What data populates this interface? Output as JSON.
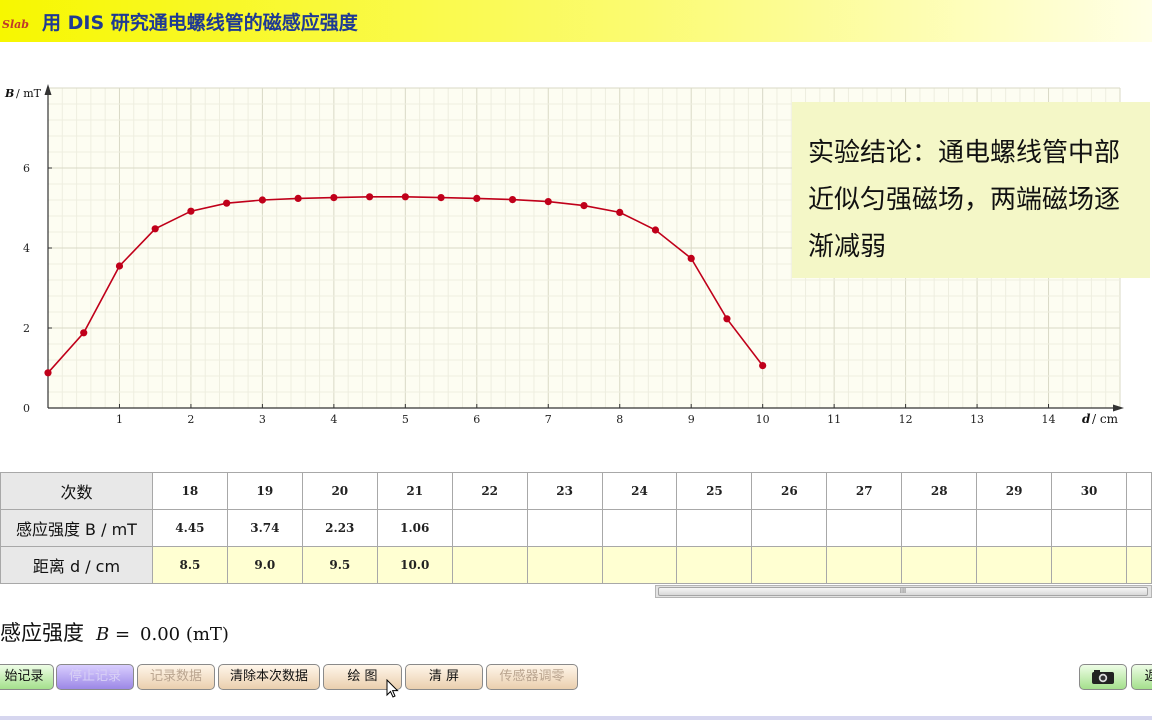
{
  "app": {
    "logo_text": "Slab",
    "title": "用 DIS 研究通电螺线管的磁感应强度"
  },
  "chart_data": {
    "type": "line",
    "xlabel_var": "d",
    "xlabel_unit": "/ cm",
    "ylabel_var": "B",
    "ylabel_unit": "/ mT",
    "xlim": [
      0,
      15
    ],
    "ylim": [
      0,
      8
    ],
    "xticks": [
      1,
      2,
      3,
      4,
      5,
      6,
      7,
      8,
      9,
      10,
      11,
      12,
      13,
      14
    ],
    "yticks": [
      0,
      2,
      4,
      6
    ],
    "grid": true,
    "series": [
      {
        "color": "#c0001a",
        "points": [
          [
            0,
            0.88
          ],
          [
            0.5,
            1.88
          ],
          [
            1,
            3.55
          ],
          [
            1.5,
            4.48
          ],
          [
            2,
            4.92
          ],
          [
            2.5,
            5.12
          ],
          [
            3,
            5.2
          ],
          [
            3.5,
            5.24
          ],
          [
            4,
            5.26
          ],
          [
            4.5,
            5.28
          ],
          [
            5,
            5.28
          ],
          [
            5.5,
            5.26
          ],
          [
            6,
            5.24
          ],
          [
            6.5,
            5.21
          ],
          [
            7,
            5.16
          ],
          [
            7.5,
            5.06
          ],
          [
            8,
            4.89
          ],
          [
            8.5,
            4.45
          ],
          [
            9,
            3.74
          ],
          [
            9.5,
            2.23
          ],
          [
            10,
            1.06
          ]
        ]
      }
    ]
  },
  "conclusion": {
    "text": "实验结论：通电螺线管中部近似匀强磁场，两端磁场逐渐减弱"
  },
  "table": {
    "row_labels": [
      "次数",
      "感应强度  B / mT",
      "距离  d / cm"
    ],
    "columns": [
      {
        "n": "18",
        "b": "4.45",
        "d": "8.5"
      },
      {
        "n": "19",
        "b": "3.74",
        "d": "9.0"
      },
      {
        "n": "20",
        "b": "2.23",
        "d": "9.5"
      },
      {
        "n": "21",
        "b": "1.06",
        "d": "10.0"
      },
      {
        "n": "22",
        "b": "",
        "d": ""
      },
      {
        "n": "23",
        "b": "",
        "d": ""
      },
      {
        "n": "24",
        "b": "",
        "d": ""
      },
      {
        "n": "25",
        "b": "",
        "d": ""
      },
      {
        "n": "26",
        "b": "",
        "d": ""
      },
      {
        "n": "27",
        "b": "",
        "d": ""
      },
      {
        "n": "28",
        "b": "",
        "d": ""
      },
      {
        "n": "29",
        "b": "",
        "d": ""
      },
      {
        "n": "30",
        "b": "",
        "d": ""
      },
      {
        "n": "",
        "b": "",
        "d": ""
      }
    ]
  },
  "scrollbar": {
    "grip": "III"
  },
  "readout": {
    "label": "感应强度",
    "var": "B =",
    "value": "0.00 (mT)"
  },
  "buttons": {
    "start": "始记录",
    "stop": "停止记录",
    "record": "记录数据",
    "clear_this": "清除本次数据",
    "plot": "绘 图",
    "clear_screen": "清 屏",
    "sensor": "传感器调零",
    "camera": "camera-icon",
    "back": "返"
  }
}
